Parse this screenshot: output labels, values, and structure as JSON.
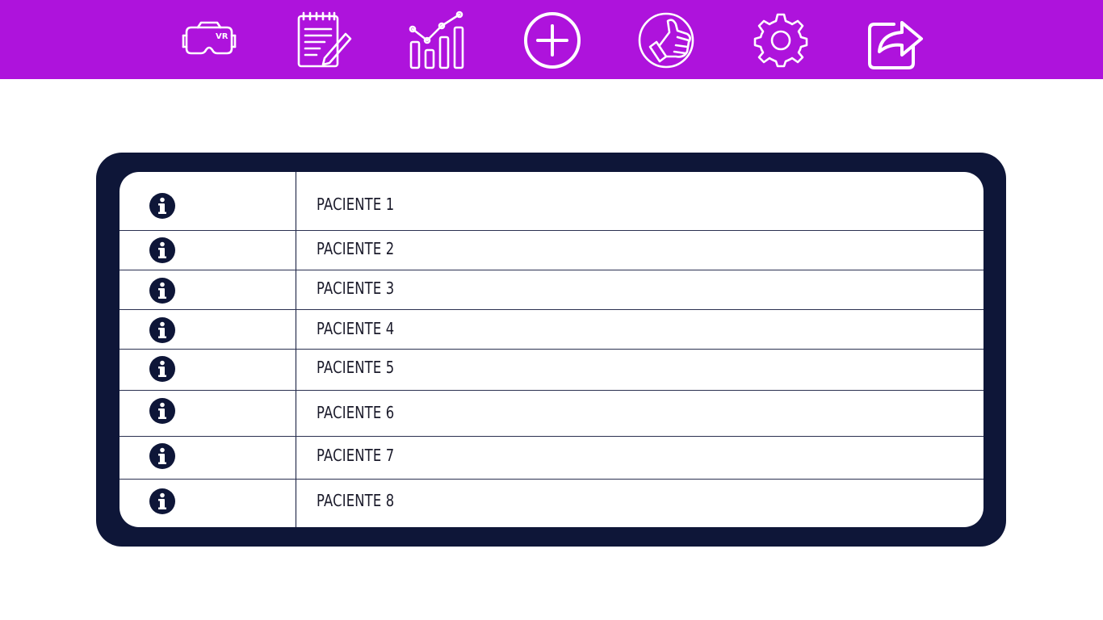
{
  "toolbar": {
    "buttons": [
      {
        "name": "vr-headset-icon"
      },
      {
        "name": "notepad-icon"
      },
      {
        "name": "analytics-chart-icon"
      },
      {
        "name": "add-circle-icon"
      },
      {
        "name": "thumbs-up-icon"
      },
      {
        "name": "gear-icon"
      },
      {
        "name": "share-icon"
      }
    ],
    "color": "#ae13dc"
  },
  "patients": [
    {
      "label": "PACIENTE 1"
    },
    {
      "label": "PACIENTE 2"
    },
    {
      "label": "PACIENTE 3"
    },
    {
      "label": "PACIENTE 4"
    },
    {
      "label": "PACIENTE 5"
    },
    {
      "label": "PACIENTE 6"
    },
    {
      "label": "PACIENTE 7"
    },
    {
      "label": "PACIENTE 8"
    }
  ],
  "colors": {
    "panel": "#0e1638",
    "background": "#ffffff"
  }
}
